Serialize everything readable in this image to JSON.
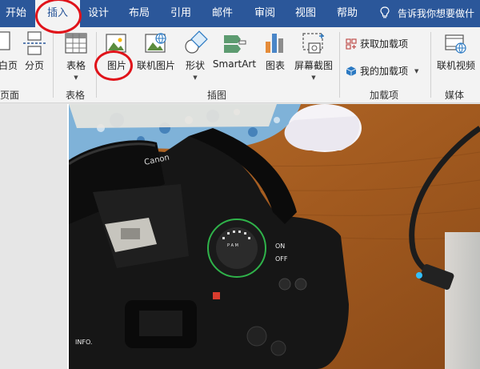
{
  "tabs": [
    {
      "label": "开始"
    },
    {
      "label": "插入"
    },
    {
      "label": "设计"
    },
    {
      "label": "布局"
    },
    {
      "label": "引用"
    },
    {
      "label": "邮件"
    },
    {
      "label": "审阅"
    },
    {
      "label": "视图"
    },
    {
      "label": "帮助"
    }
  ],
  "tell_me": "告诉我你想要做什",
  "ribbon": {
    "pages": {
      "page_break_label": "分页",
      "partial_label": "白页",
      "group": "页面"
    },
    "tables": {
      "table_label": "表格",
      "group": "表格"
    },
    "illustrations": {
      "pictures_label": "图片",
      "online_pictures_label": "联机图片",
      "shapes_label": "形状",
      "smartart_label": "SmartArt",
      "chart_label": "图表",
      "screenshot_label": "屏幕截图",
      "group": "插图"
    },
    "addins": {
      "get_addins_label": "获取加载项",
      "my_addins_label": "我的加载项",
      "group": "加载项"
    },
    "media": {
      "online_video_label": "联机视频",
      "group": "媒体"
    }
  },
  "camera": {
    "brand": "Canon",
    "mode_dial": "P A M",
    "on_label": "ON",
    "off_label": "OFF",
    "info_label": "INFO."
  },
  "colors": {
    "tabbar": "#2b579a",
    "ribbon": "#f3f3f3",
    "annotation": "#e0131a",
    "dial_highlight": "#2fb34a"
  }
}
